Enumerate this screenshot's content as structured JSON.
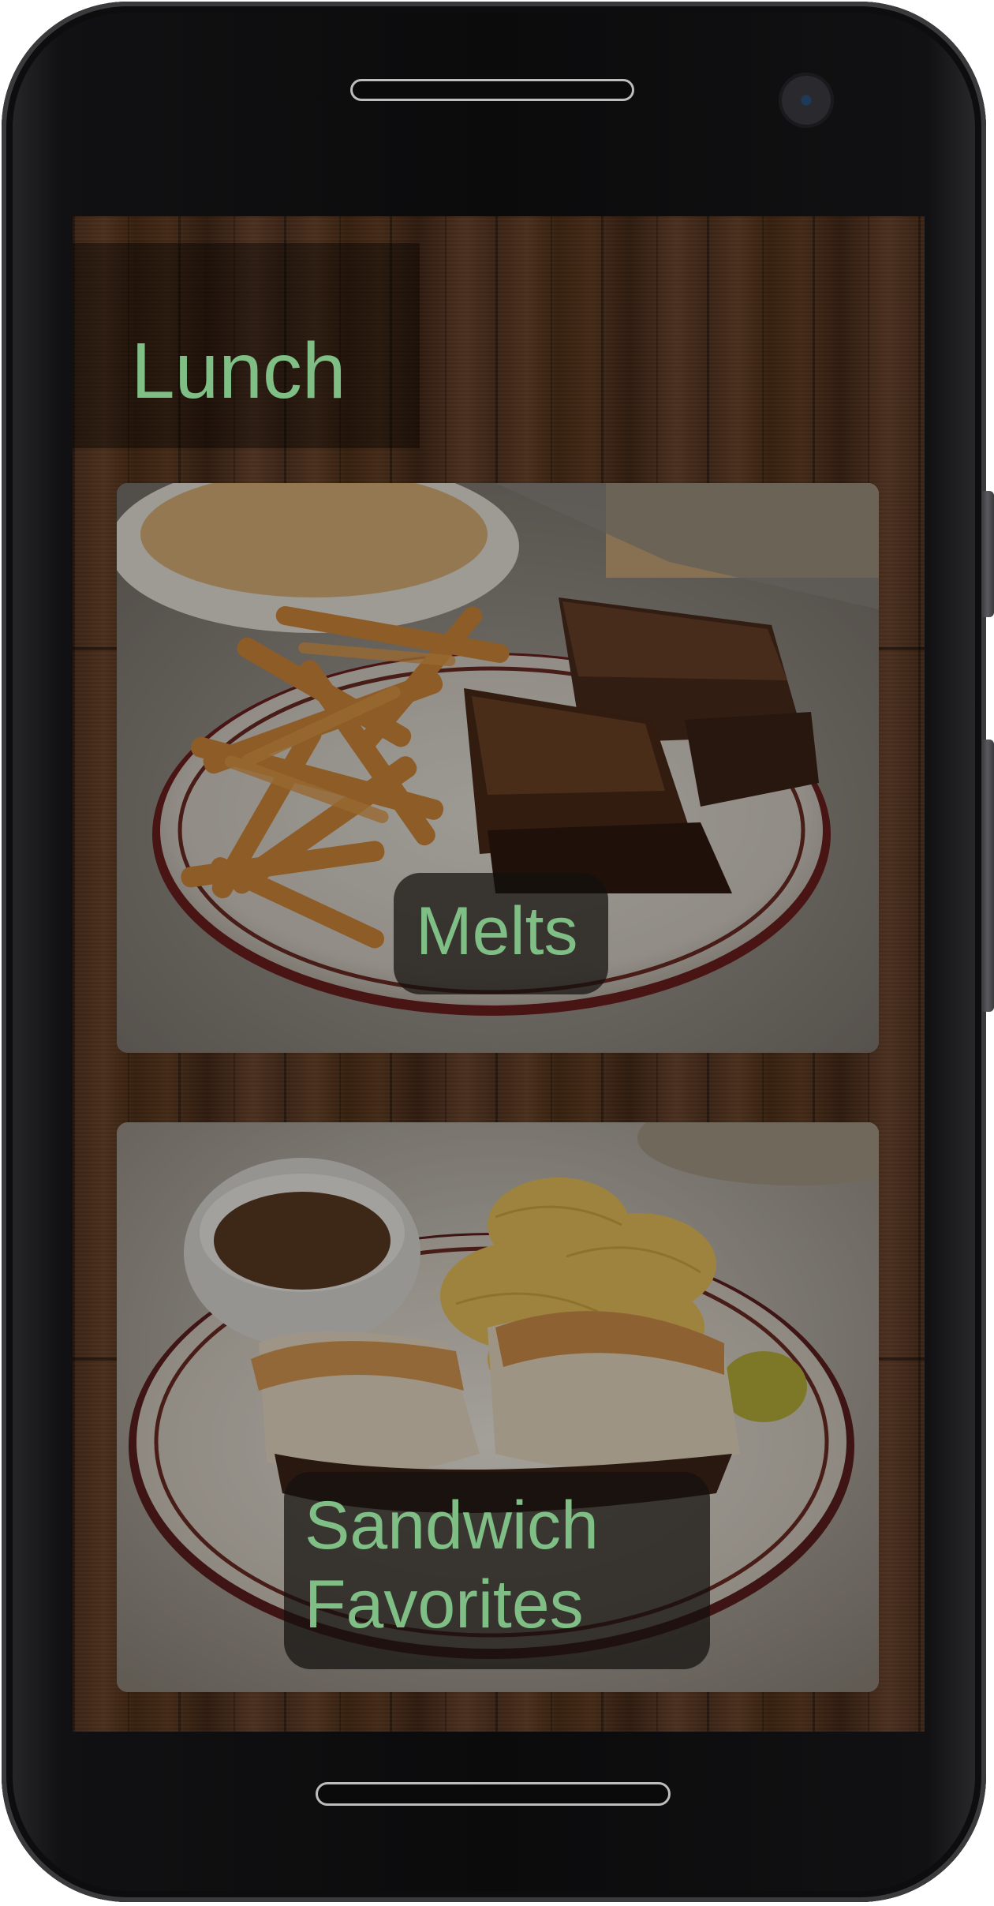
{
  "page": {
    "title": "Lunch"
  },
  "categories": [
    {
      "label": "Melts"
    },
    {
      "label_line1": "Sandwich",
      "label_line2": "Favorites"
    }
  ],
  "colors": {
    "accent_text": "#7fbf86",
    "label_background": "#14100e",
    "wood": "#3b2416"
  },
  "icons": {
    "speaker": "earpiece-speaker-icon",
    "camera": "front-camera-icon",
    "home": "home-indicator-icon"
  }
}
